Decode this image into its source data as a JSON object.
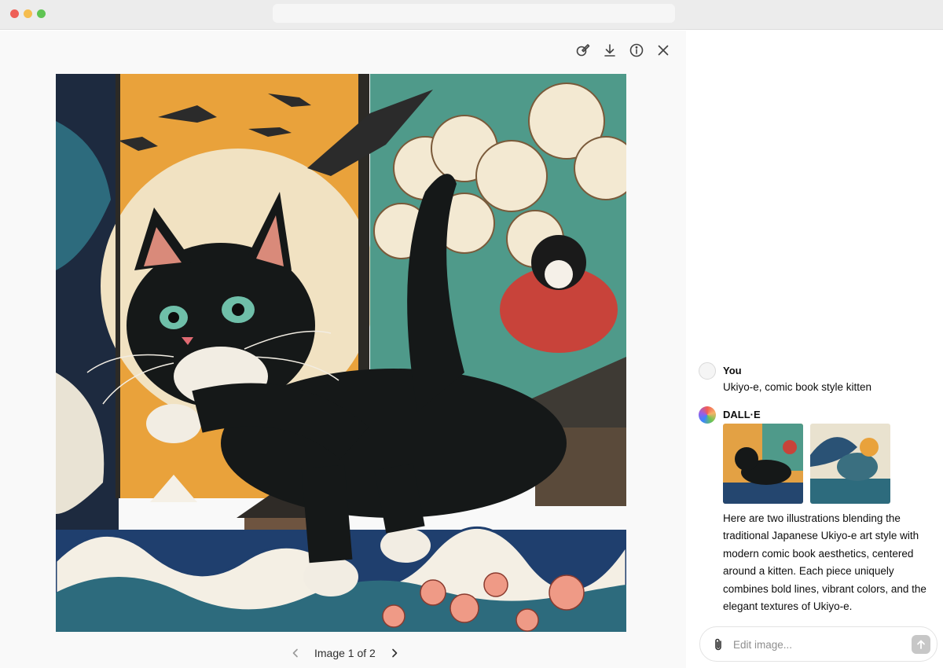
{
  "viewer": {
    "toolbar": [
      {
        "name": "edit-icon"
      },
      {
        "name": "download-icon"
      },
      {
        "name": "info-icon"
      },
      {
        "name": "close-icon"
      }
    ],
    "pager": {
      "label": "Image 1 of 2",
      "prev_icon": "chevron-left-icon",
      "next_icon": "chevron-right-icon"
    }
  },
  "chat": {
    "user": {
      "name": "You",
      "message": "Ukiyo-e, comic book style kitten"
    },
    "assistant": {
      "name": "DALL·E",
      "reply": "Here are two illustrations blending the traditional Japanese Ukiyo-e art style with modern comic book aesthetics, centered around a kitten. Each piece uniquely combines bold lines, vibrant colors, and the elegant textures of Ukiyo-e."
    },
    "composer": {
      "placeholder": "Edit image...",
      "attach_icon": "paperclip-icon",
      "send_icon": "arrow-up-icon"
    }
  },
  "colors": {
    "panel_bg": "#f9f9f9",
    "send_disabled": "#c7c7c7"
  }
}
